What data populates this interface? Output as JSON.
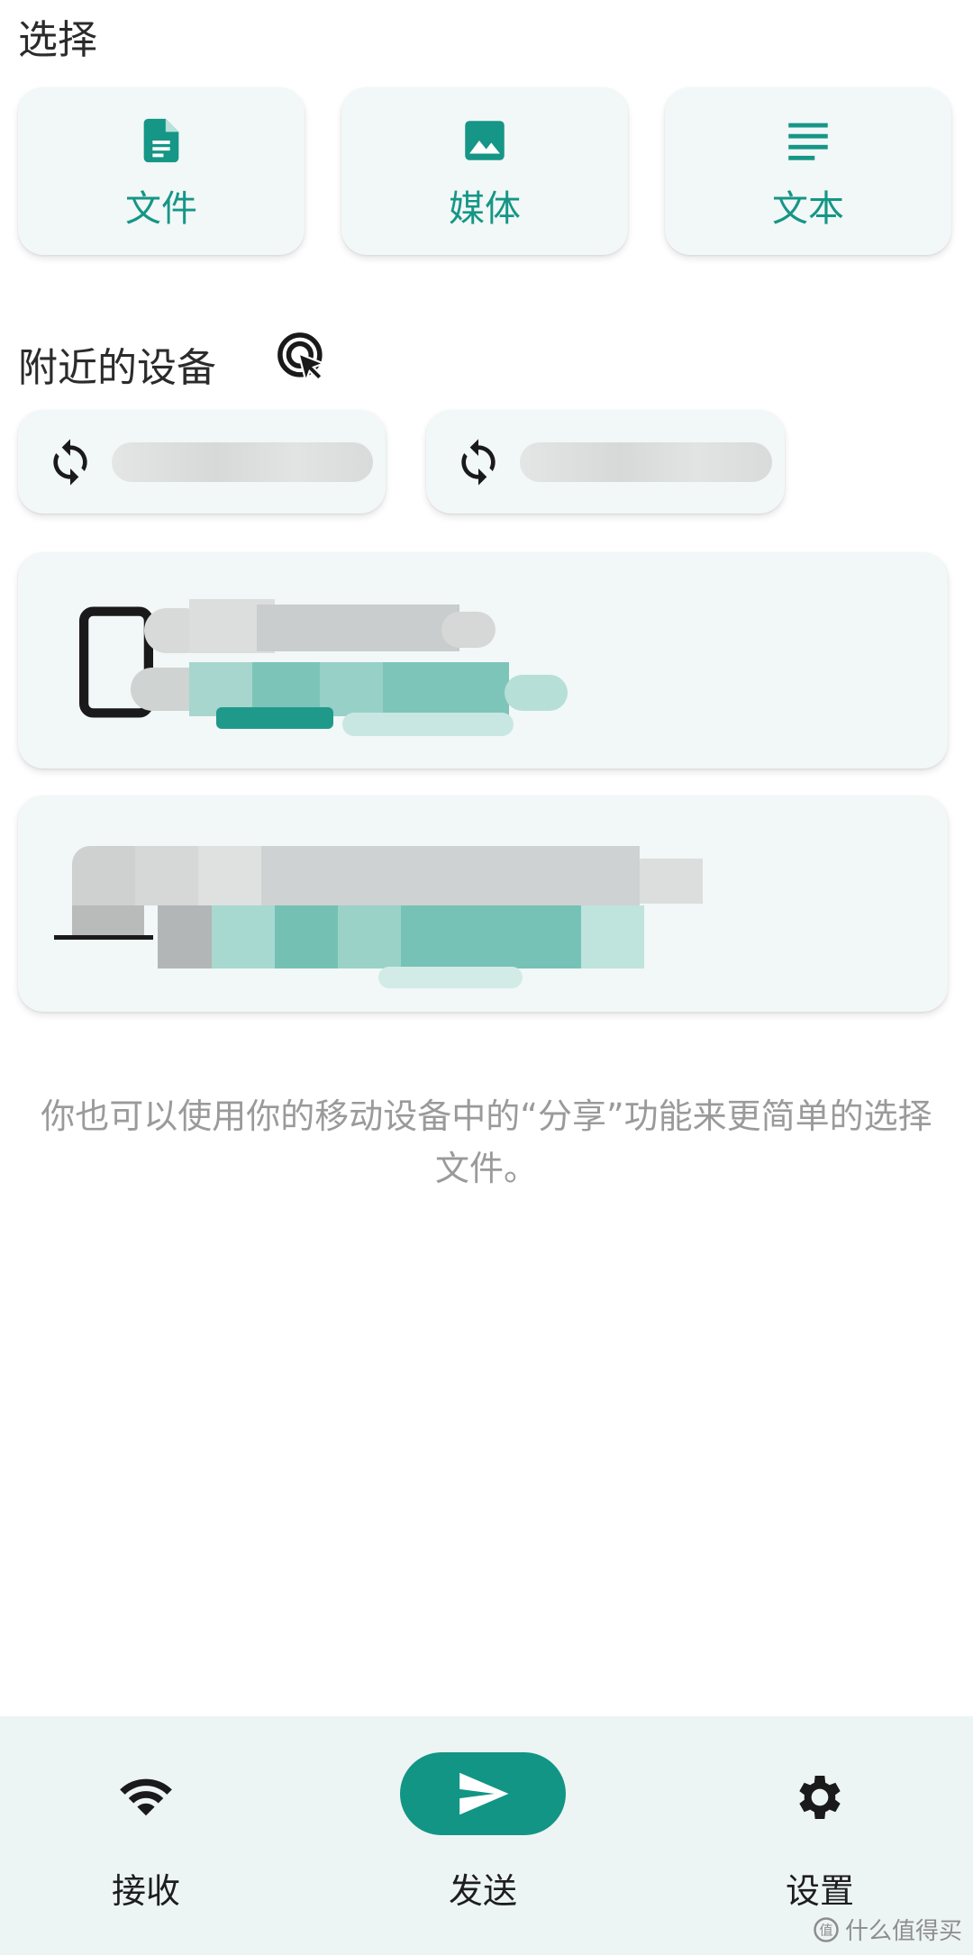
{
  "select": {
    "title": "选择",
    "options": [
      {
        "label": "文件",
        "icon": "file-icon"
      },
      {
        "label": "媒体",
        "icon": "image-icon"
      },
      {
        "label": "文本",
        "icon": "text-icon"
      }
    ]
  },
  "nearby": {
    "title": "附近的设备",
    "scan_icon": "scan-touch-icon",
    "refresh_icon": "sync-icon"
  },
  "hint_text": "你也可以使用你的移动设备中的“分享”功能来更简单的选择文件。",
  "bottom_nav": {
    "items": [
      {
        "label": "接收",
        "icon": "wifi-icon"
      },
      {
        "label": "发送",
        "icon": "send-icon"
      },
      {
        "label": "设置",
        "icon": "gear-icon"
      }
    ]
  },
  "watermark": "什么值得买",
  "colors": {
    "accent": "#129585",
    "card_bg": "#f2f7f7",
    "nav_bg": "#edf5f4"
  }
}
